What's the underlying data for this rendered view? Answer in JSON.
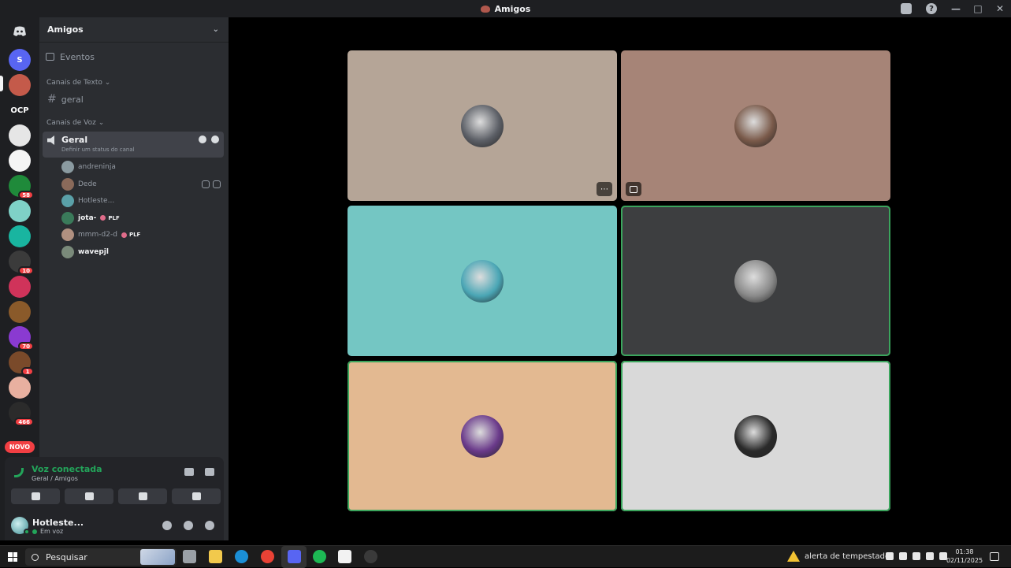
{
  "window": {
    "title": "Amigos"
  },
  "sidebar": {
    "server_name": "Amigos",
    "events_label": "Eventos",
    "text_category": "Canais de Texto",
    "text_channels": [
      "geral"
    ],
    "voice_category": "Canais de Voz",
    "voice_channel": {
      "name": "Geral",
      "status_placeholder": "Definir um status do canal"
    },
    "voice_users": [
      {
        "name": "andreninja",
        "tag": "",
        "bright": false,
        "muted": false
      },
      {
        "name": "Dede",
        "tag": "",
        "bright": false,
        "muted": true
      },
      {
        "name": "Hotleste...",
        "tag": "",
        "bright": false,
        "muted": false
      },
      {
        "name": "jota-",
        "tag": "PLF",
        "bright": true,
        "muted": false
      },
      {
        "name": "mmm-d2-d",
        "tag": "PLF",
        "bright": false,
        "muted": false
      },
      {
        "name": "wavepjl",
        "tag": "",
        "bright": true,
        "muted": false
      }
    ]
  },
  "rail": {
    "servers": [
      {
        "label": "S",
        "color": "#5865f2"
      },
      {
        "label": "",
        "color": "#c45a4a",
        "badge": ""
      },
      {
        "label": "OCP",
        "color": "#1e1f22"
      },
      {
        "label": "",
        "color": "#e6e6e6"
      },
      {
        "label": "",
        "color": "#f5f5f5"
      },
      {
        "label": "",
        "color": "#1f8a3a",
        "badge": "58"
      },
      {
        "label": "",
        "color": "#7fd1c7"
      },
      {
        "label": "",
        "color": "#19b5a0"
      },
      {
        "label": "",
        "color": "#3b3b3b",
        "badge": "10"
      },
      {
        "label": "",
        "color": "#d0335a"
      },
      {
        "label": "",
        "color": "#8a5a2a"
      },
      {
        "label": "",
        "color": "#8a3ad1",
        "badge": "70"
      },
      {
        "label": "",
        "color": "#7a4a2a",
        "badge": "1"
      },
      {
        "label": "",
        "color": "#e8b0a0"
      },
      {
        "label": "",
        "color": "#2b2b2b",
        "badge": "466"
      }
    ],
    "novo_label": "NOVO"
  },
  "voice_panel": {
    "title": "Voz conectada",
    "subtitle": "Geral / Amigos"
  },
  "user": {
    "name": "Hotleste...",
    "status": "Em voz"
  },
  "tiles": [
    {
      "bg": "#b5a597",
      "speaking": false,
      "avatar": "#5c5f66",
      "more": true,
      "icon": false
    },
    {
      "bg": "#a68477",
      "speaking": false,
      "avatar": "#7a5a4a",
      "more": false,
      "icon": true
    },
    {
      "bg": "#74c6c3",
      "speaking": false,
      "avatar": "#4aa6b5",
      "more": false,
      "icon": false
    },
    {
      "bg": "#3d3e40",
      "speaking": true,
      "avatar": "#8a8a8a",
      "more": false,
      "icon": false
    },
    {
      "bg": "#e3b991",
      "speaking": true,
      "avatar": "#6a3a8a",
      "more": false,
      "icon": false
    },
    {
      "bg": "#d9d9d9",
      "speaking": true,
      "avatar": "#2a2a2a",
      "more": false,
      "icon": false
    }
  ],
  "taskbar": {
    "search_placeholder": "Pesquisar",
    "weather": "alerta de tempestade",
    "time": "01:38",
    "date": "02/11/2025",
    "apps": [
      {
        "name": "task-view",
        "color": "#9aa0a6"
      },
      {
        "name": "file-explorer",
        "color": "#f2c94c"
      },
      {
        "name": "edge",
        "color": "#1b8fd6"
      },
      {
        "name": "chrome",
        "color": "#e94235"
      },
      {
        "name": "discord",
        "color": "#5865f2"
      },
      {
        "name": "spotify",
        "color": "#1db954"
      },
      {
        "name": "notepad",
        "color": "#f2f2f2"
      },
      {
        "name": "obs",
        "color": "#3a3a3a"
      }
    ]
  }
}
